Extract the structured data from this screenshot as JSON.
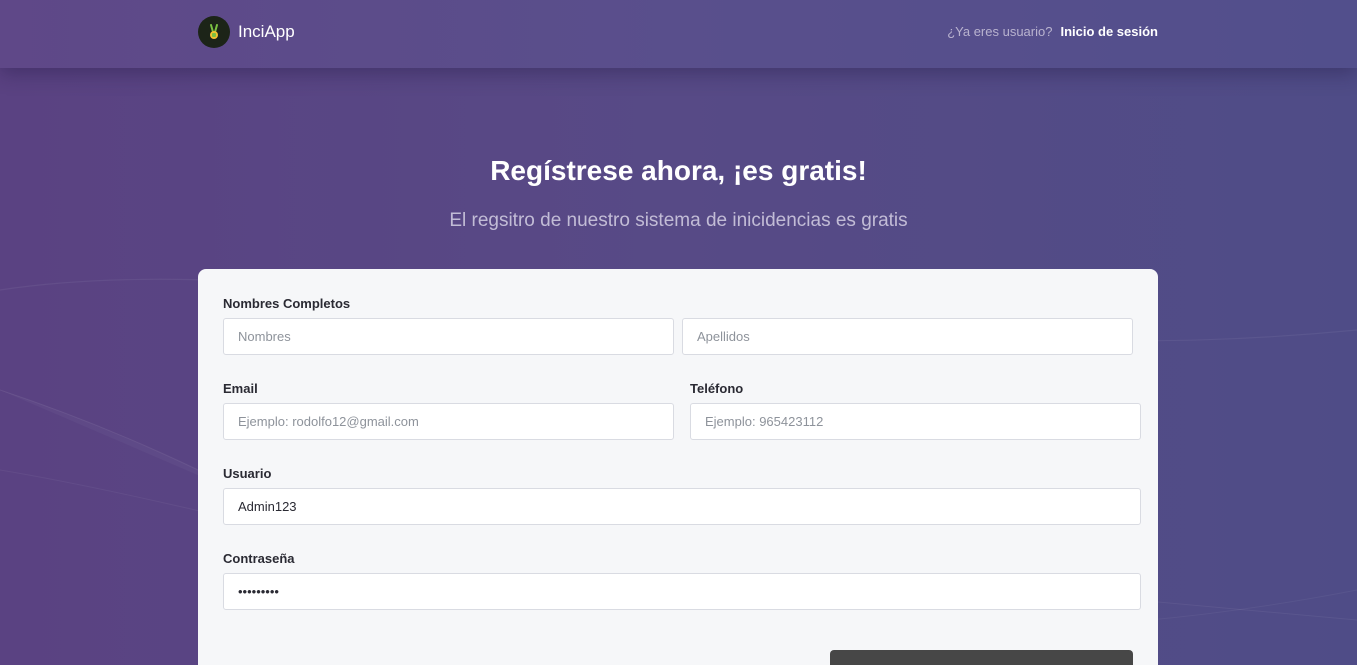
{
  "header": {
    "brand_name": "InciApp",
    "logo_icon": "peace-hand-icon",
    "login_prompt": "¿Ya eres usuario?",
    "login_link": "Inicio de sesión"
  },
  "hero": {
    "title": "Regístrese ahora, ¡es gratis!",
    "subtitle": "El regsitro de nuestro sistema de inicidencias es gratis"
  },
  "form": {
    "full_name": {
      "label": "Nombres Completos",
      "first_name_placeholder": "Nombres",
      "first_name_value": "",
      "last_name_placeholder": "Apellidos",
      "last_name_value": ""
    },
    "email": {
      "label": "Email",
      "placeholder": "Ejemplo: rodolfo12@gmail.com",
      "value": ""
    },
    "phone": {
      "label": "Teléfono",
      "placeholder": "Ejemplo: 965423112",
      "value": ""
    },
    "username": {
      "label": "Usuario",
      "value": "Admin123"
    },
    "password": {
      "label": "Contraseña",
      "value": "admin1234"
    },
    "submit_label": ""
  },
  "colors": {
    "background": "#574a86",
    "card": "#f6f7f9",
    "button": "#474747",
    "logo_green": "#7cc242"
  }
}
